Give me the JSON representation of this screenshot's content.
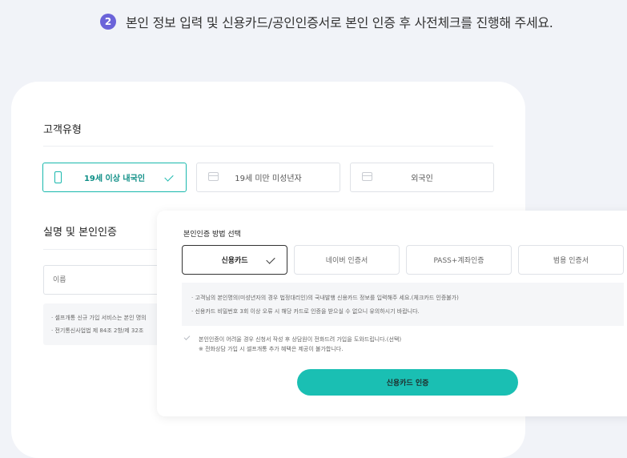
{
  "step": {
    "number": "2",
    "text": "본인 정보 입력 및 신용카드/공인인증서로 본인 인증 후 사전체크를 진행해 주세요."
  },
  "customer_type": {
    "title": "고객유형",
    "options": [
      {
        "label": "19세 이상 내국인",
        "icon": "mobile-phone-icon",
        "selected": true
      },
      {
        "label": "19세 미만 미성년자",
        "icon": "card-icon",
        "selected": false
      },
      {
        "label": "외국인",
        "icon": "card-icon",
        "selected": false
      }
    ]
  },
  "verification": {
    "title": "실명 및 본인인증",
    "name_placeholder": "이름",
    "notices": [
      "셀프개통 신규 가입 서비스는 본인 명의",
      "전기통신사업법 제 84조 2항/제 32조"
    ]
  },
  "auth_modal": {
    "title": "본인인증 방법 선택",
    "methods": [
      {
        "label": "신용카드",
        "selected": true
      },
      {
        "label": "네이버 인증서",
        "selected": false
      },
      {
        "label": "PASS+계좌인증",
        "selected": false
      },
      {
        "label": "범용 인증서",
        "selected": false
      }
    ],
    "info": [
      "고객님의 본인명의(미성년자의 경우 법정대리인)의 국내발행 신용카드 정보를 입력해주 세요.(체크카드 인증불가)",
      "신용카드 비밀번호 3회 이상 오류 시 해당 카드로 인증을 받으실 수 없으니 유의하시기 바랍니다."
    ],
    "agree_line1": "본인인증이 어려울 경우 신청서 작성 후 상담원이 전화드려 가입을 도와드립니다.(선택)",
    "agree_line2": "※ 전화상담 가입 시 셀프개통 추가 혜택은 제공이 불가합니다.",
    "cta_label": "신용카드 인증"
  },
  "colors": {
    "accent": "#1abfb3",
    "step_badge": "#6b63d9",
    "background": "#f1f3f8"
  }
}
